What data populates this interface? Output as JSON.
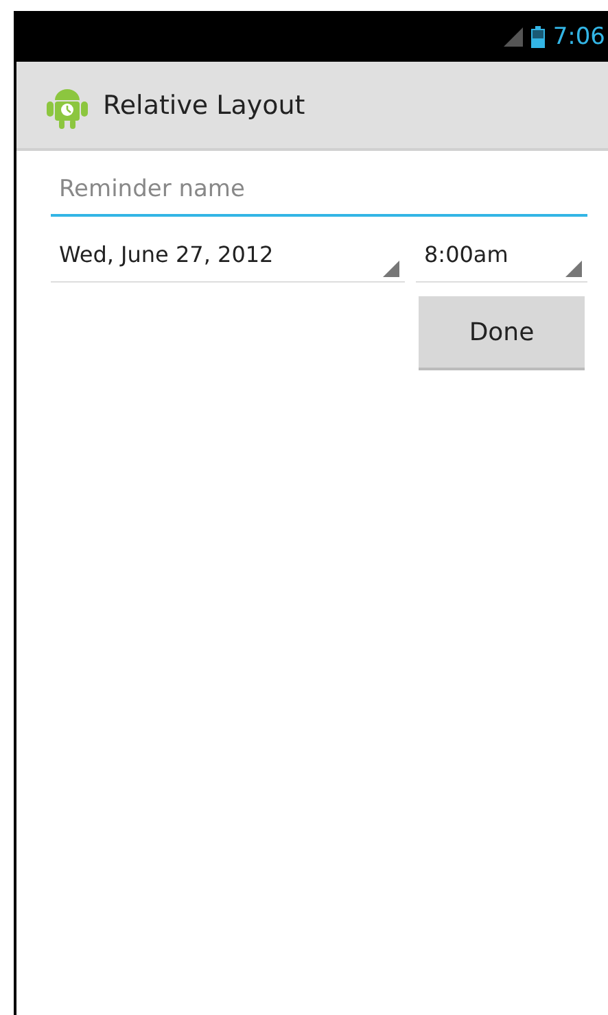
{
  "status_bar": {
    "time": "7:06"
  },
  "action_bar": {
    "title": "Relative Layout"
  },
  "reminder_field": {
    "placeholder": "Reminder name"
  },
  "spinners": [
    {
      "kind": "date",
      "value": "Wed, June 27, 2012"
    },
    {
      "kind": "time",
      "value": "8:00am"
    }
  ],
  "buttons": [
    "Done"
  ]
}
